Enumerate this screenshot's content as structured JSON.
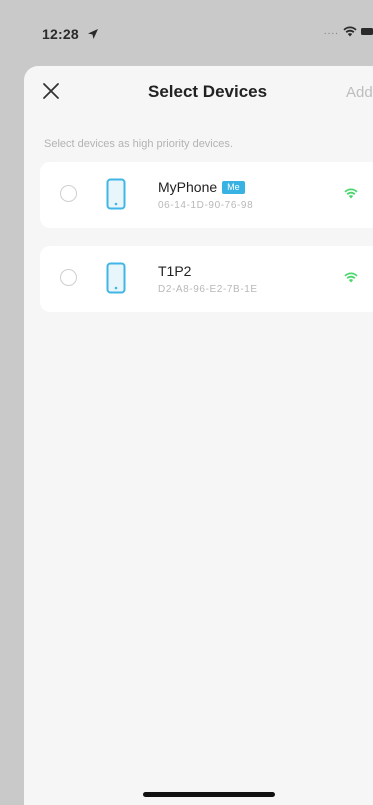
{
  "status_bar": {
    "time": "12:28",
    "signal_text": "....",
    "icons": [
      "location-arrow-icon",
      "wifi-icon",
      "battery-icon"
    ]
  },
  "nav": {
    "title": "Select Devices",
    "add_label": "Add",
    "close_icon": "close-icon"
  },
  "hint": "Select devices as high priority devices.",
  "devices": [
    {
      "name": "MyPhone",
      "badge": "Me",
      "mac": "06-14-1D-90-76-98",
      "selected": false,
      "icon": "phone-icon",
      "signal_icon": "wifi-icon"
    },
    {
      "name": "T1P2",
      "badge": "",
      "mac": "D2-A8-96-E2-7B-1E",
      "selected": false,
      "icon": "phone-icon",
      "signal_icon": "wifi-icon"
    }
  ],
  "colors": {
    "accent_blue": "#37b2e3",
    "wifi_green": "#4cd66e",
    "backdrop": "#c9c9c9",
    "sheet": "#f6f6f6"
  }
}
